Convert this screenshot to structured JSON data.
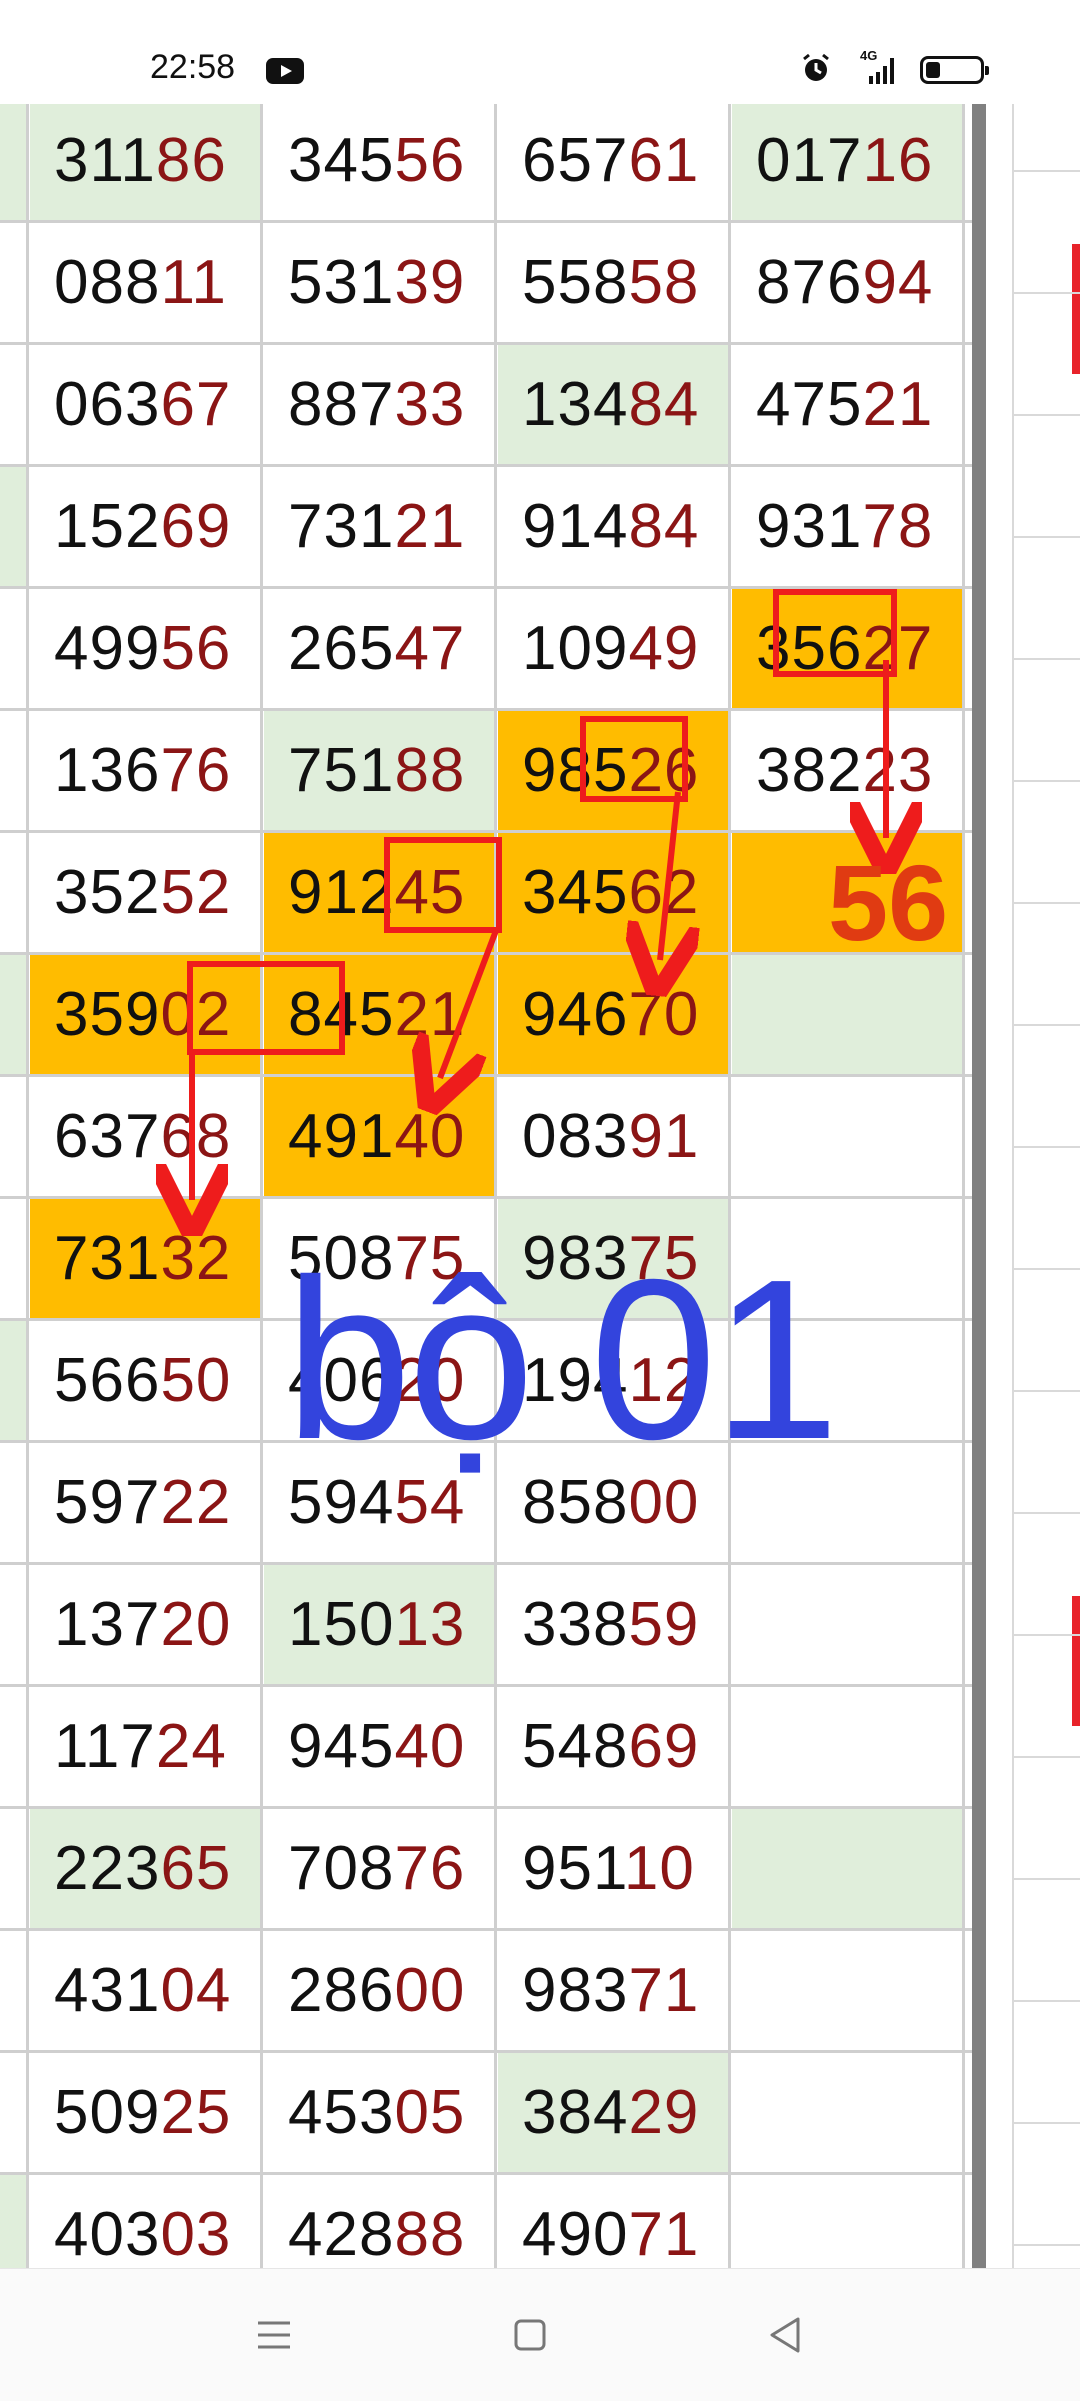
{
  "status_bar": {
    "time": "22:58",
    "icons": [
      "youtube-icon",
      "alarm-icon",
      "signal-4g-icon",
      "battery-icon"
    ],
    "network": "4G"
  },
  "colors": {
    "highlight_orange": "#ffbc00",
    "highlight_green": "#e0eedb",
    "digit_black": "#111111",
    "digit_dark_red": "#8b1515",
    "annotation_red": "#ee1c1c",
    "annotation_blue": "#3344dd"
  },
  "table": {
    "rows": [
      [
        {
          "head": "311",
          "tail": "86",
          "hl": "green"
        },
        {
          "head": "345",
          "tail": "56"
        },
        {
          "head": "657",
          "tail": "61"
        },
        {
          "head": "017",
          "tail": "16",
          "hl": "green"
        }
      ],
      [
        {
          "head": "088",
          "tail": "11"
        },
        {
          "head": "531",
          "tail": "39"
        },
        {
          "head": "558",
          "tail": "58"
        },
        {
          "head": "876",
          "tail": "94"
        }
      ],
      [
        {
          "head": "063",
          "tail": "67"
        },
        {
          "head": "887",
          "tail": "33"
        },
        {
          "head": "134",
          "tail": "84",
          "hl": "green"
        },
        {
          "head": "475",
          "tail": "21"
        }
      ],
      [
        {
          "head": "152",
          "tail": "69"
        },
        {
          "head": "731",
          "tail": "21"
        },
        {
          "head": "914",
          "tail": "84"
        },
        {
          "head": "931",
          "tail": "78"
        }
      ],
      [
        {
          "head": "499",
          "tail": "56"
        },
        {
          "head": "265",
          "tail": "47"
        },
        {
          "head": "109",
          "tail": "49"
        },
        {
          "head": "356",
          "tail": "27",
          "hl": "orange"
        }
      ],
      [
        {
          "head": "136",
          "tail": "76"
        },
        {
          "head": "751",
          "tail": "88",
          "hl": "green"
        },
        {
          "head": "985",
          "tail": "26",
          "hl": "orange"
        },
        {
          "head": "382",
          "tail": "23"
        }
      ],
      [
        {
          "head": "352",
          "tail": "52"
        },
        {
          "head": "912",
          "tail": "45",
          "hl": "orange"
        },
        {
          "head": "345",
          "tail": "62",
          "hl": "orange"
        },
        {
          "head": "",
          "tail": "",
          "hl": "orange"
        }
      ],
      [
        {
          "head": "359",
          "tail": "02",
          "hl": "orange"
        },
        {
          "head": "845",
          "tail": "21",
          "hl": "orange"
        },
        {
          "head": "946",
          "tail": "70",
          "hl": "orange"
        },
        {
          "head": "",
          "tail": "",
          "hl": "green"
        }
      ],
      [
        {
          "head": "637",
          "tail": "68"
        },
        {
          "head": "491",
          "tail": "40",
          "hl": "orange"
        },
        {
          "head": "083",
          "tail": "91"
        },
        {
          "head": "",
          "tail": ""
        }
      ],
      [
        {
          "head": "731",
          "tail": "32",
          "hl": "orange"
        },
        {
          "head": "508",
          "tail": "75"
        },
        {
          "head": "983",
          "tail": "75",
          "hl": "green"
        },
        {
          "head": "",
          "tail": ""
        }
      ],
      [
        {
          "head": "566",
          "tail": "50"
        },
        {
          "head": "406",
          "tail": "20"
        },
        {
          "head": "194",
          "tail": "12"
        },
        {
          "head": "",
          "tail": ""
        }
      ],
      [
        {
          "head": "597",
          "tail": "22"
        },
        {
          "head": "594",
          "tail": "54"
        },
        {
          "head": "858",
          "tail": "00"
        },
        {
          "head": "",
          "tail": ""
        }
      ],
      [
        {
          "head": "137",
          "tail": "20"
        },
        {
          "head": "150",
          "tail": "13",
          "hl": "green"
        },
        {
          "head": "338",
          "tail": "59"
        },
        {
          "head": "",
          "tail": ""
        }
      ],
      [
        {
          "head": "117",
          "tail": "24"
        },
        {
          "head": "945",
          "tail": "40"
        },
        {
          "head": "548",
          "tail": "69"
        },
        {
          "head": "",
          "tail": ""
        }
      ],
      [
        {
          "head": "223",
          "tail": "65",
          "hl": "green"
        },
        {
          "head": "708",
          "tail": "76"
        },
        {
          "head": "951",
          "tail": "10"
        },
        {
          "head": "",
          "tail": "",
          "hl": "green"
        }
      ],
      [
        {
          "head": "431",
          "tail": "04"
        },
        {
          "head": "286",
          "tail": "00"
        },
        {
          "head": "983",
          "tail": "71"
        },
        {
          "head": "",
          "tail": ""
        }
      ],
      [
        {
          "head": "509",
          "tail": "25"
        },
        {
          "head": "453",
          "tail": "05"
        },
        {
          "head": "384",
          "tail": "29",
          "hl": "green"
        },
        {
          "head": "",
          "tail": ""
        }
      ],
      [
        {
          "head": "403",
          "tail": "03"
        },
        {
          "head": "428",
          "tail": "88"
        },
        {
          "head": "490",
          "tail": "71"
        },
        {
          "head": "",
          "tail": ""
        }
      ]
    ],
    "left_sliver_green_rows": [
      0,
      3,
      7,
      10,
      17
    ]
  },
  "annotations": {
    "predicted_number": "56",
    "set_label": "bộ 01"
  },
  "navbar": {
    "icons": [
      "menu-icon",
      "home-square-icon",
      "back-triangle-icon"
    ]
  }
}
